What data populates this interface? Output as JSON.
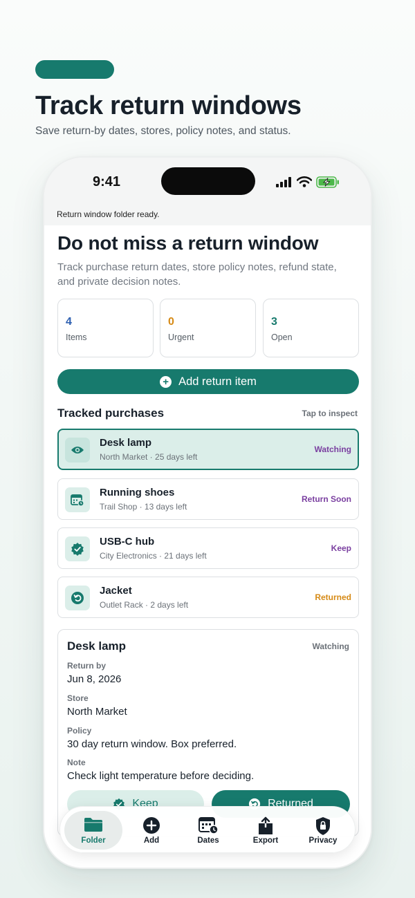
{
  "hero": {
    "title": "Track return windows",
    "subtitle": "Save return-by dates, stores, policy notes, and status."
  },
  "status_bar": {
    "time": "9:41"
  },
  "banner": "Return window folder ready.",
  "page": {
    "title": "Do not miss a return window",
    "intro": "Track purchase return dates, store policy notes, refund state, and private decision notes."
  },
  "stats": [
    {
      "value": "4",
      "label": "Items",
      "color": "#2d5fb0"
    },
    {
      "value": "0",
      "label": "Urgent",
      "color": "#d68a16"
    },
    {
      "value": "3",
      "label": "Open",
      "color": "#177a6d"
    }
  ],
  "add_button": {
    "label": "Add return item"
  },
  "section": {
    "title": "Tracked purchases",
    "hint": "Tap to inspect"
  },
  "items": [
    {
      "name": "Desk lamp",
      "meta": "North Market · 25 days left",
      "status": "Watching",
      "status_color": "#7a3fa0",
      "icon": "eye-icon"
    },
    {
      "name": "Running shoes",
      "meta": "Trail Shop · 13 days left",
      "status": "Return Soon",
      "status_color": "#7a3fa0",
      "icon": "calendar-clock-icon"
    },
    {
      "name": "USB-C hub",
      "meta": "City Electronics · 21 days left",
      "status": "Keep",
      "status_color": "#7a3fa0",
      "icon": "verified-check-icon"
    },
    {
      "name": "Jacket",
      "meta": "Outlet Rack · 2 days left",
      "status": "Returned",
      "status_color": "#d68a16",
      "icon": "return-arrow-icon"
    }
  ],
  "detail": {
    "title": "Desk lamp",
    "status": "Watching",
    "return_by_label": "Return by",
    "return_by": "Jun 8, 2026",
    "store_label": "Store",
    "store": "North Market",
    "policy_label": "Policy",
    "policy": "30 day return window. Box preferred.",
    "note_label": "Note",
    "note": "Check light temperature before deciding.",
    "keep_label": "Keep",
    "returned_label": "Returned"
  },
  "tabs": [
    {
      "label": "Folder",
      "icon": "folder-icon",
      "active": true
    },
    {
      "label": "Add",
      "icon": "add-circle-icon",
      "active": false
    },
    {
      "label": "Dates",
      "icon": "calendar-icon",
      "active": false
    },
    {
      "label": "Export",
      "icon": "share-icon",
      "active": false
    },
    {
      "label": "Privacy",
      "icon": "lock-shield-icon",
      "active": false
    }
  ],
  "colors": {
    "accent": "#177a6d",
    "accent_light": "#dbeee9",
    "text": "#17202a",
    "muted": "#6b7178"
  }
}
